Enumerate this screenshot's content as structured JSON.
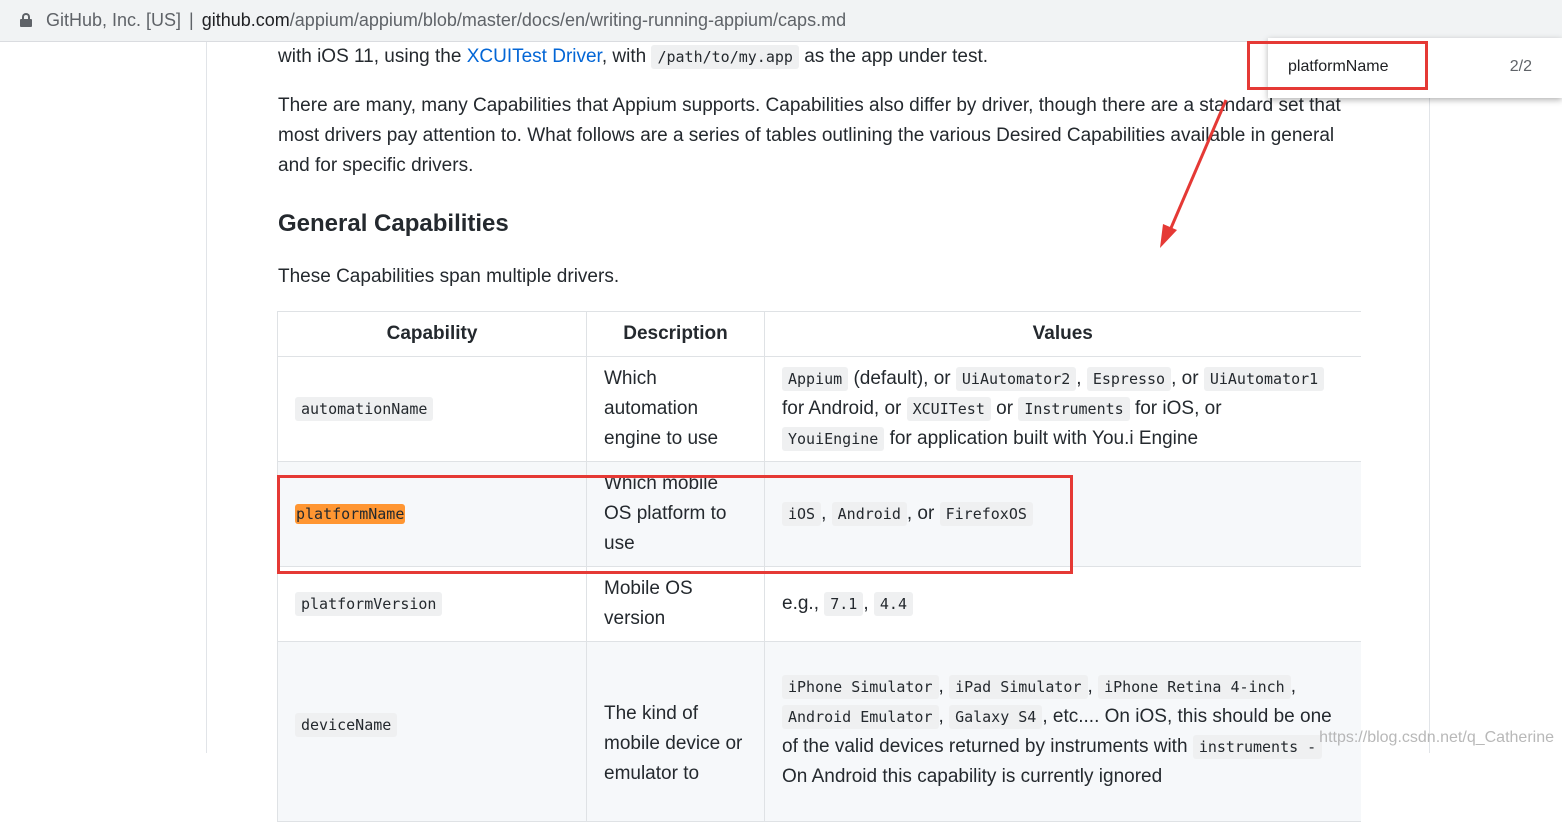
{
  "address_bar": {
    "site_identity": "GitHub, Inc. [US]",
    "separator": "|",
    "url_host": "github.com",
    "url_path": "/appium/appium/blob/master/docs/en/writing-running-appium/caps.md"
  },
  "doc": {
    "p1_prefix": "with iOS 11, using the ",
    "p1_link": "XCUITest Driver",
    "p1_mid": ", with ",
    "p1_code": "/path/to/my.app",
    "p1_suffix": " as the app under test.",
    "p2": "There are many, many Capabilities that Appium supports. Capabilities also differ by driver, though there are a standard set that most drivers pay attention to. What follows are a series of tables outlining the various Desired Capabilities available in general and for specific drivers.",
    "heading": "General Capabilities",
    "p3": "These Capabilities span multiple drivers."
  },
  "table": {
    "headers": [
      "Capability",
      "Description",
      "Values"
    ],
    "rows": [
      {
        "capability": "automationName",
        "description": "Which automation engine to use",
        "values": {
          "c1": "Appium",
          "t1": " (default), or ",
          "c2": "UiAutomator2",
          "t2": ", ",
          "c3": "Espresso",
          "t3": ", or ",
          "c4": "UiAutomator1",
          "t4": " for Android, or ",
          "c5": "XCUITest",
          "t5": " or ",
          "c6": "Instruments",
          "t6": " for iOS, or ",
          "c7": "YouiEngine",
          "t7": " for application built with You.i Engine"
        }
      },
      {
        "capability": "platformName",
        "description": "Which mobile OS platform to use",
        "values": {
          "c1": "iOS",
          "t1": ", ",
          "c2": "Android",
          "t2": ", or ",
          "c3": "FirefoxOS"
        }
      },
      {
        "capability": "platformVersion",
        "description": "Mobile OS version",
        "values": {
          "t0": "e.g., ",
          "c1": "7.1",
          "t1": ", ",
          "c2": "4.4"
        }
      },
      {
        "capability": "deviceName",
        "description": "The kind of mobile device or emulator to",
        "values": {
          "c1": "iPhone Simulator",
          "t1": ", ",
          "c2": "iPad Simulator",
          "t2": ", ",
          "c3": "iPhone Retina 4-inch",
          "t3": ", ",
          "c4": "Android Emulator",
          "t4": ", ",
          "c5": "Galaxy S4",
          "t5": ", etc.... On iOS, this should be one of the valid devices returned by instruments with ",
          "c6": "instruments -",
          "t6": " On Android this capability is currently ignored"
        }
      }
    ]
  },
  "find_bar": {
    "query": "platformName",
    "count": "2/2"
  },
  "annotation_colors": {
    "box": "#e53935",
    "highlight": "#ff9632"
  },
  "watermark": "https://blog.csdn.net/q_Catherine"
}
